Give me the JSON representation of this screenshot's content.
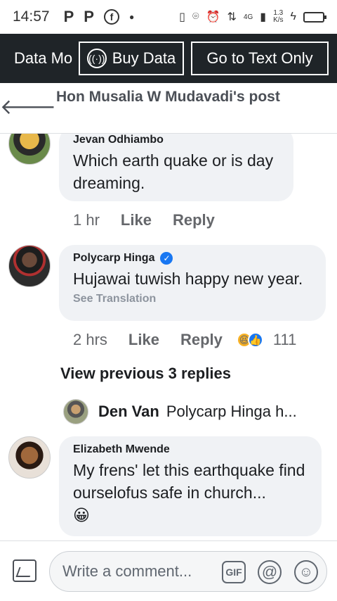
{
  "status_bar": {
    "time": "14:57",
    "notif1": "P",
    "notif2": "P",
    "notif3": "f",
    "network": "4G",
    "speed_value": "1.3",
    "speed_unit": "K/s"
  },
  "data_bar": {
    "mode_label": "Data Mo",
    "buy_label": "Buy Data",
    "text_only_label": "Go to Text Only"
  },
  "header": {
    "back_icon": "arrow-left-icon",
    "title": "Hon Musalia W Mudavadi's post"
  },
  "comments": [
    {
      "author": "Jevan Odhiambo",
      "text": "Which earth quake or is day dreaming.",
      "time": "1 hr",
      "like": "Like",
      "reply": "Reply"
    },
    {
      "author": "Polycarp Hinga",
      "verified": true,
      "text": "Hujawai tuwish happy new year.",
      "translate": "See Translation",
      "time": "2 hrs",
      "like": "Like",
      "reply": "Reply",
      "reaction_count": "111"
    },
    {
      "author": "Elizabeth Mwende",
      "text": "My frens' let this earthquake find ourselofus safe in church...",
      "emoji": "😀"
    }
  ],
  "view_previous": "View previous 3 replies",
  "reply_preview": {
    "author": "Den Van",
    "text": "Polycarp Hinga h..."
  },
  "composer": {
    "placeholder": "Write a comment...",
    "gif_label": "GIF",
    "at_label": "@"
  },
  "colors": {
    "data_bar_bg": "#1f2428",
    "bubble_bg": "#f0f2f5",
    "verified_blue": "#1877f2"
  }
}
